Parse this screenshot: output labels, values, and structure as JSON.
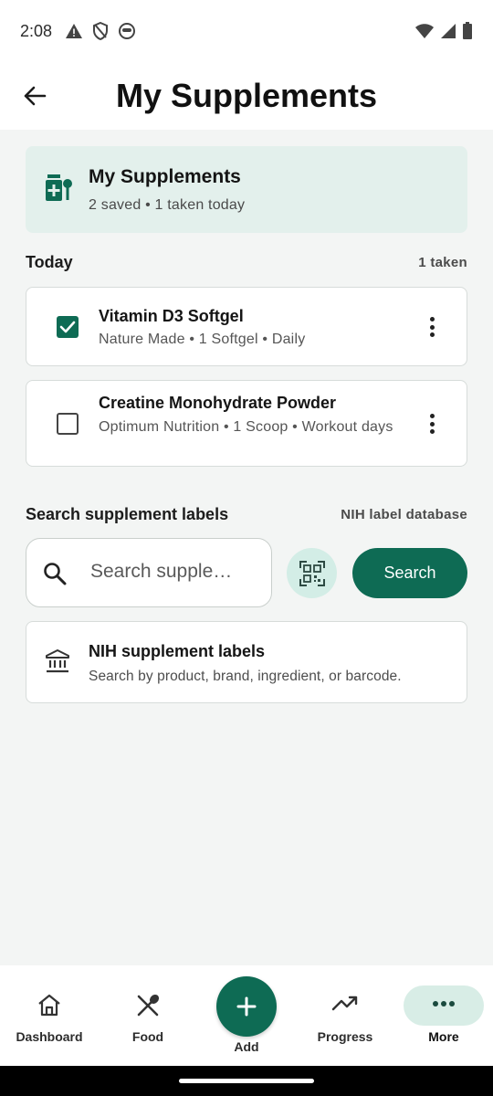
{
  "status_bar": {
    "time": "2:08"
  },
  "header": {
    "title": "My Supplements"
  },
  "summary": {
    "title": "My Supplements",
    "subtitle": "2 saved • 1 taken today"
  },
  "today": {
    "title": "Today",
    "count_label": "1 taken",
    "items": [
      {
        "name": "Vitamin D3 Softgel",
        "detail": "Nature Made • 1 Softgel • Daily",
        "taken": true
      },
      {
        "name": "Creatine Monohydrate Powder",
        "detail": "Optimum Nutrition • 1 Scoop • Workout days",
        "taken": false
      }
    ]
  },
  "search": {
    "title": "Search supplement labels",
    "source": "NIH label database",
    "placeholder": "Search supple…",
    "button_label": "Search"
  },
  "nih_card": {
    "title": "NIH supplement labels",
    "subtitle": "Search by product, brand, ingredient, or barcode."
  },
  "bottom_nav": {
    "items": [
      {
        "label": "Dashboard",
        "icon": "home-icon"
      },
      {
        "label": "Food",
        "icon": "utensils-icon"
      },
      {
        "label": "Add",
        "icon": "plus-icon"
      },
      {
        "label": "Progress",
        "icon": "trending-up-icon"
      },
      {
        "label": "More",
        "icon": "more-horizontal-icon",
        "selected": true
      }
    ]
  },
  "colors": {
    "accent": "#0e6b54",
    "accent_light": "#d3ede6",
    "summary_bg": "#e3f0ec",
    "background": "#f3f5f4"
  }
}
